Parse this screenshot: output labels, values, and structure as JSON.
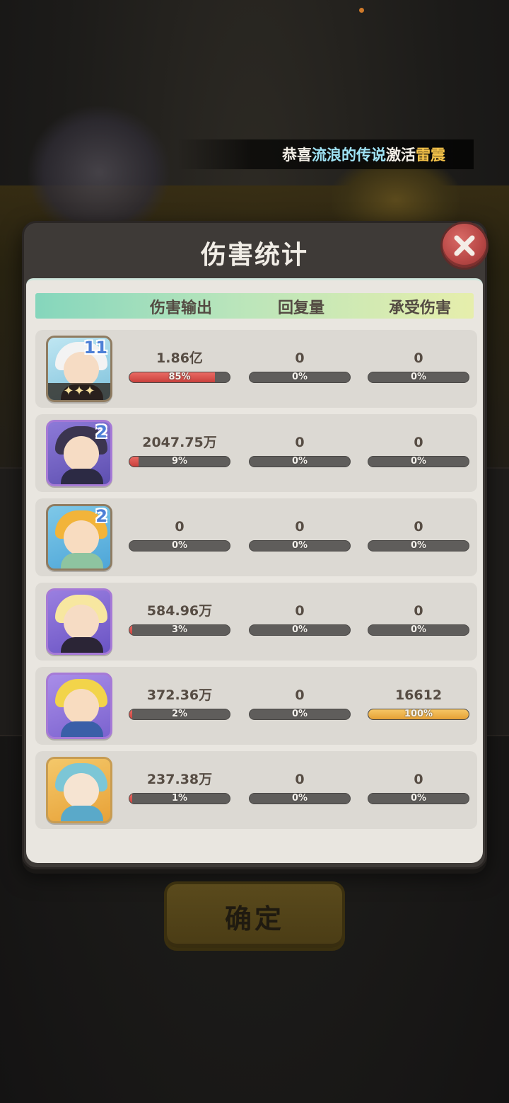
{
  "notice": {
    "prefix": "恭喜",
    "player": "流浪的传说",
    "middle": "激活",
    "item": "雷震"
  },
  "dialog": {
    "title": "伤害统计",
    "columns": {
      "damage_out": "伤害输出",
      "healing": "回复量",
      "damage_taken": "承受伤害"
    },
    "rows": [
      {
        "level": "11",
        "stars": "✦✦✦",
        "damage_out": {
          "value": "1.86亿",
          "pct": "85%",
          "ratio": 0.85
        },
        "healing": {
          "value": "0",
          "pct": "0%",
          "ratio": 0
        },
        "damage_taken": {
          "value": "0",
          "pct": "0%",
          "ratio": 0
        }
      },
      {
        "level": "2",
        "damage_out": {
          "value": "2047.75万",
          "pct": "9%",
          "ratio": 0.09
        },
        "healing": {
          "value": "0",
          "pct": "0%",
          "ratio": 0
        },
        "damage_taken": {
          "value": "0",
          "pct": "0%",
          "ratio": 0
        }
      },
      {
        "level": "2",
        "damage_out": {
          "value": "0",
          "pct": "0%",
          "ratio": 0
        },
        "healing": {
          "value": "0",
          "pct": "0%",
          "ratio": 0
        },
        "damage_taken": {
          "value": "0",
          "pct": "0%",
          "ratio": 0
        }
      },
      {
        "level": "",
        "damage_out": {
          "value": "584.96万",
          "pct": "3%",
          "ratio": 0.03
        },
        "healing": {
          "value": "0",
          "pct": "0%",
          "ratio": 0
        },
        "damage_taken": {
          "value": "0",
          "pct": "0%",
          "ratio": 0
        }
      },
      {
        "level": "",
        "damage_out": {
          "value": "372.36万",
          "pct": "2%",
          "ratio": 0.02
        },
        "healing": {
          "value": "0",
          "pct": "0%",
          "ratio": 0
        },
        "damage_taken": {
          "value": "16612",
          "pct": "100%",
          "ratio": 1.0
        }
      },
      {
        "level": "",
        "damage_out": {
          "value": "237.38万",
          "pct": "1%",
          "ratio": 0.01
        },
        "healing": {
          "value": "0",
          "pct": "0%",
          "ratio": 0
        },
        "damage_taken": {
          "value": "0",
          "pct": "0%",
          "ratio": 0
        }
      }
    ]
  },
  "confirm_label": "确定",
  "colors": {
    "damage_bar": "#d9504b",
    "taken_bar": "#f0b44e",
    "header_start": "#85d6bc",
    "header_end": "#e6eeac"
  }
}
